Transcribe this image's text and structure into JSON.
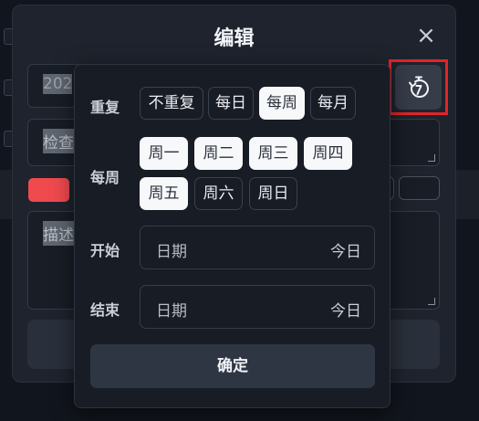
{
  "dialog": {
    "title": "编辑",
    "close_icon": "×",
    "date_prefix": "202",
    "title_prefix": "检查",
    "desc_prefix": "描述",
    "accent_color": "#f04a4e"
  },
  "repeat_button": {
    "icon": "repeat-clock-icon",
    "highlight_color": "#e2232a"
  },
  "popover": {
    "repeat_label": "重复",
    "repeat_options": [
      {
        "label": "不重复",
        "selected": false
      },
      {
        "label": "每日",
        "selected": false
      },
      {
        "label": "每周",
        "selected": true
      },
      {
        "label": "每月",
        "selected": false
      }
    ],
    "weekly_label": "每周",
    "weekdays": [
      {
        "label": "周一",
        "selected": true
      },
      {
        "label": "周二",
        "selected": true
      },
      {
        "label": "周三",
        "selected": true
      },
      {
        "label": "周四",
        "selected": true
      },
      {
        "label": "周五",
        "selected": true
      },
      {
        "label": "周六",
        "selected": false
      },
      {
        "label": "周日",
        "selected": false
      }
    ],
    "start_label": "开始",
    "start_placeholder": "日期",
    "start_today": "今日",
    "end_label": "结束",
    "end_placeholder": "日期",
    "end_today": "今日",
    "confirm_label": "确定"
  }
}
